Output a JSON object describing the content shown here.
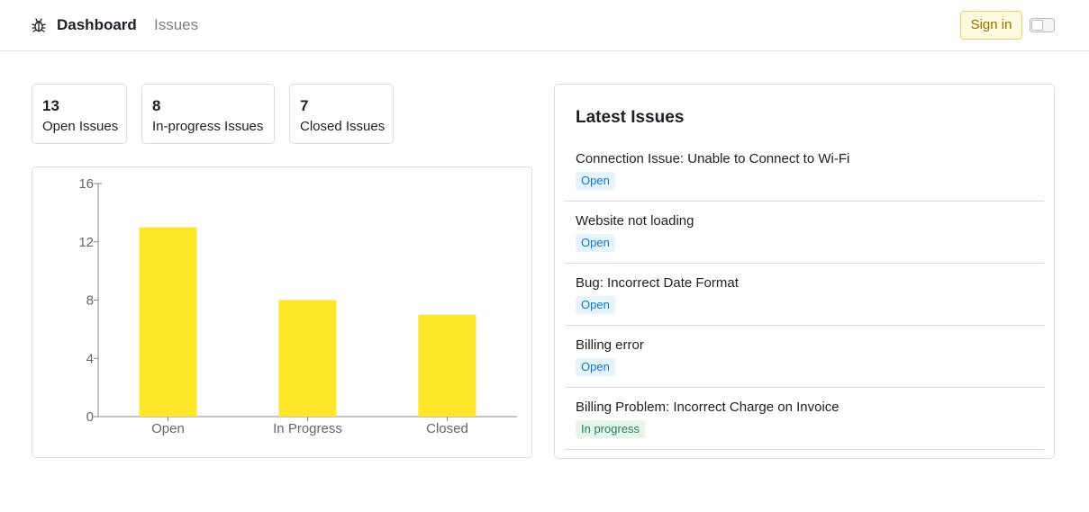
{
  "nav": {
    "logo_icon": "bug-icon",
    "dashboard_label": "Dashboard",
    "issues_label": "Issues",
    "signin_label": "Sign in",
    "theme_toggle_icon": "toggle-switch-icon"
  },
  "stats": [
    {
      "value": "13",
      "label": "Open Issues"
    },
    {
      "value": "8",
      "label": "In-progress Issues"
    },
    {
      "value": "7",
      "label": "Closed Issues"
    }
  ],
  "chart_data": {
    "type": "bar",
    "categories": [
      "Open",
      "In Progress",
      "Closed"
    ],
    "values": [
      13,
      8,
      7
    ],
    "yticks": [
      0,
      4,
      8,
      12,
      16
    ],
    "ylim": [
      0,
      16
    ],
    "bar_color": "#ffe629",
    "grid": false
  },
  "latest": {
    "title": "Latest Issues",
    "items": [
      {
        "title": "Connection Issue: Unable to Connect to Wi-Fi",
        "status": "Open",
        "status_type": "open"
      },
      {
        "title": "Website not loading",
        "status": "Open",
        "status_type": "open"
      },
      {
        "title": "Bug: Incorrect Date Format",
        "status": "Open",
        "status_type": "open"
      },
      {
        "title": "Billing error",
        "status": "Open",
        "status_type": "open"
      },
      {
        "title": "Billing Problem: Incorrect Charge on Invoice",
        "status": "In progress",
        "status_type": "progress"
      }
    ]
  },
  "colors": {
    "open_badge_bg": "#e6f4fe",
    "open_badge_text": "#0d74ce",
    "progress_badge_bg": "#e6f6eb",
    "progress_badge_text": "#218358",
    "signin_bg": "#fffbe0",
    "signin_text": "#9a6b00"
  }
}
